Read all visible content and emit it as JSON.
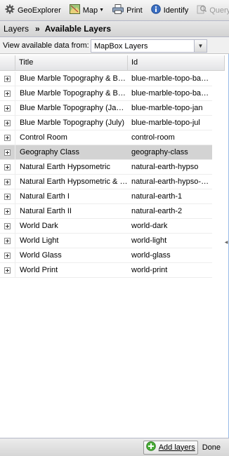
{
  "toolbar": {
    "app_title": "GeoExplorer",
    "map_label": "Map",
    "print_label": "Print",
    "identify_label": "Identify",
    "query_label": "Query"
  },
  "breadcrumb": {
    "parent": "Layers",
    "separator": "»",
    "current": "Available Layers"
  },
  "source": {
    "label": "View available data from:",
    "selected": "MapBox Layers"
  },
  "grid": {
    "columns": {
      "title": "Title",
      "id": "Id"
    },
    "rows": [
      {
        "title": "Blue Marble Topography & Bathymetry (January)",
        "id": "blue-marble-topo-bathy-jan"
      },
      {
        "title": "Blue Marble Topography & Bathymetry (July)",
        "id": "blue-marble-topo-bathy-jul"
      },
      {
        "title": "Blue Marble Topography (January)",
        "id": "blue-marble-topo-jan"
      },
      {
        "title": "Blue Marble Topography (July)",
        "id": "blue-marble-topo-jul"
      },
      {
        "title": "Control Room",
        "id": "control-room"
      },
      {
        "title": "Geography Class",
        "id": "geography-class"
      },
      {
        "title": "Natural Earth Hypsometric",
        "id": "natural-earth-hypso"
      },
      {
        "title": "Natural Earth Hypsometric & Bathymetry",
        "id": "natural-earth-hypso-bathy"
      },
      {
        "title": "Natural Earth I",
        "id": "natural-earth-1"
      },
      {
        "title": "Natural Earth II",
        "id": "natural-earth-2"
      },
      {
        "title": "World Dark",
        "id": "world-dark"
      },
      {
        "title": "World Light",
        "id": "world-light"
      },
      {
        "title": "World Glass",
        "id": "world-glass"
      },
      {
        "title": "World Print",
        "id": "world-print"
      }
    ],
    "selected_index": 5
  },
  "footer": {
    "add_label": "Add layers",
    "done_label": "Done"
  },
  "icons": {
    "app": "gear-icon",
    "map": "map-icon",
    "print": "printer-icon",
    "identify": "info-icon",
    "query": "query-icon",
    "add": "add-circle-icon",
    "expander": "plus-box-icon"
  }
}
